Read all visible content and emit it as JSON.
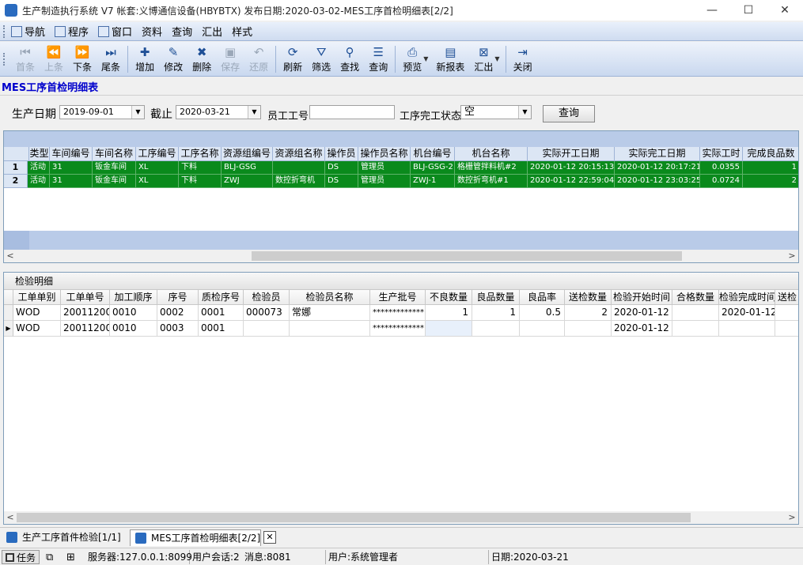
{
  "window": {
    "title": "生产制造执行系统 V7 帐套:义博通信设备(HBYBTX) 发布日期:2020-03-02-MES工序首检明细表[2/2]",
    "minimize": "—",
    "maximize": "☐",
    "close": "✕"
  },
  "menubar": {
    "items": [
      "导航",
      "程序",
      "窗口",
      "资料",
      "查询",
      "汇出",
      "样式"
    ]
  },
  "toolbar": {
    "first": "首条",
    "prev": "上条",
    "next": "下条",
    "last": "尾条",
    "add": "增加",
    "edit": "修改",
    "delete": "删除",
    "save": "保存",
    "undo": "还原",
    "refresh": "刷新",
    "filter": "筛选",
    "find": "查找",
    "query": "查询",
    "preview": "预览",
    "new_report": "新报表",
    "export": "汇出",
    "close": "关闭"
  },
  "page_title": "MES工序首检明细表",
  "filters": {
    "date_label": "生产日期",
    "date_from": "2019-09-01",
    "to_label": "截止",
    "date_to": "2020-03-21",
    "employee_label": "员工工号",
    "employee_value": "",
    "status_label": "工序完工状态",
    "status_value": "空",
    "query_button": "查询"
  },
  "grid1": {
    "headers": [
      "类型",
      "车间编号",
      "车间名称",
      "工序编号",
      "工序名称",
      "资源组编号",
      "资源组名称",
      "操作员",
      "操作员名称",
      "机台编号",
      "机台名称",
      "实际开工日期",
      "实际完工日期",
      "实际工时",
      "完成良品数"
    ],
    "rows": [
      {
        "num": "1",
        "cells": [
          "活动",
          "31",
          "钣金车间",
          "XL",
          "下料",
          "BLJ-GSG",
          "",
          "DS",
          "管理员",
          "BLJ-GSG-2",
          "格栅管拌料机#2",
          "2020-01-12 20:15:13",
          "2020-01-12 20:17:21",
          "0.0355",
          "1"
        ]
      },
      {
        "num": "2",
        "cells": [
          "活动",
          "31",
          "钣金车间",
          "XL",
          "下料",
          "ZWJ",
          "数控折弯机",
          "DS",
          "管理员",
          "ZWJ-1",
          "数控折弯机#1",
          "2020-01-12 22:59:04",
          "2020-01-12 23:03:25",
          "0.0724",
          "2"
        ]
      }
    ],
    "scroll_left": "<",
    "scroll_right": ">"
  },
  "grid2": {
    "caption": "检验明细",
    "headers": [
      "工单单别",
      "工单单号",
      "加工顺序",
      "序号",
      "质检序号",
      "检验员",
      "检验员名称",
      "生产批号",
      "不良数量",
      "良品数量",
      "良品率",
      "送检数量",
      "检验开始时间",
      "合格数量",
      "检验完成时间",
      "送检"
    ],
    "rows": [
      {
        "indicator": "",
        "cells": [
          "WOD",
          "20011200",
          "0010",
          "0002",
          "0001",
          "000073",
          "常娜",
          "*************",
          "1",
          "1",
          "0.5",
          "2",
          "2020-01-12 2",
          "",
          "2020-01-12",
          ""
        ]
      },
      {
        "indicator": "▶",
        "cells": [
          "WOD",
          "20011200",
          "0010",
          "0003",
          "0001",
          "",
          "",
          "*************",
          "",
          "",
          "",
          "",
          "2020-01-12 2",
          "",
          "",
          ""
        ]
      }
    ],
    "scroll_left": "<",
    "scroll_right": ">"
  },
  "tabs": [
    {
      "label": "生产工序首件检验[1/1]"
    },
    {
      "label": "MES工序首检明细表[2/2]"
    }
  ],
  "tab_close": "✕",
  "statusbar": {
    "task": "任务",
    "server": "服务器:127.0.0.1:8099",
    "sessions": "用户会话:2",
    "message": "消息:8081",
    "user": "用户:系统管理者",
    "date": "日期:2020-03-21"
  }
}
